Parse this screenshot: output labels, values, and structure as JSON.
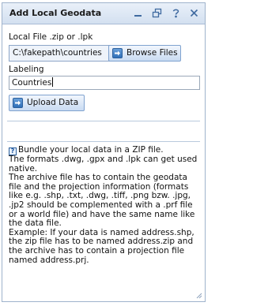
{
  "window": {
    "title": "Add Local Geodata",
    "icons": [
      "minimize-icon",
      "restore-icon",
      "help-icon",
      "close-icon"
    ]
  },
  "file_section": {
    "label": "Local File .zip or .lpk",
    "value": "C:\\fakepath\\countries",
    "browse_label": "Browse Files"
  },
  "labeling": {
    "label": "Labeling",
    "value": "Countries"
  },
  "upload": {
    "label": "Upload Data"
  },
  "help": {
    "lines": [
      "Bundle your local data in a ZIP file.",
      "The formats .dwg, .gpx and .lpk can get used native.",
      "The archive file has to contain the geodata file and the projection information (formats like e.g. .shp, .txt, .dwg, .tiff, .png bzw. .jpg, .jp2 should be complemented with a .prf file or a world file) and have the same name like the data file.",
      "Example: If your data is named address.shp, the zip file has to be named address.zip and the archive has to contain a projection file named address.prj."
    ]
  },
  "colors": {
    "titlebar": "#d3e0f0",
    "accent": "#2f6fb7",
    "border": "#9fb3cc"
  }
}
